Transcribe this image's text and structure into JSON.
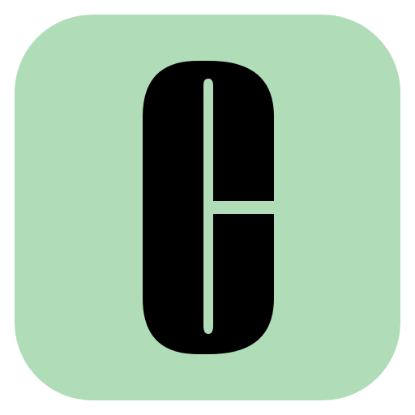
{
  "icon": {
    "name": "app-icon",
    "glyph": "stencil-letter-c-icon",
    "colors": {
      "background": "#b0ddb7",
      "glyph": "#000000"
    }
  }
}
